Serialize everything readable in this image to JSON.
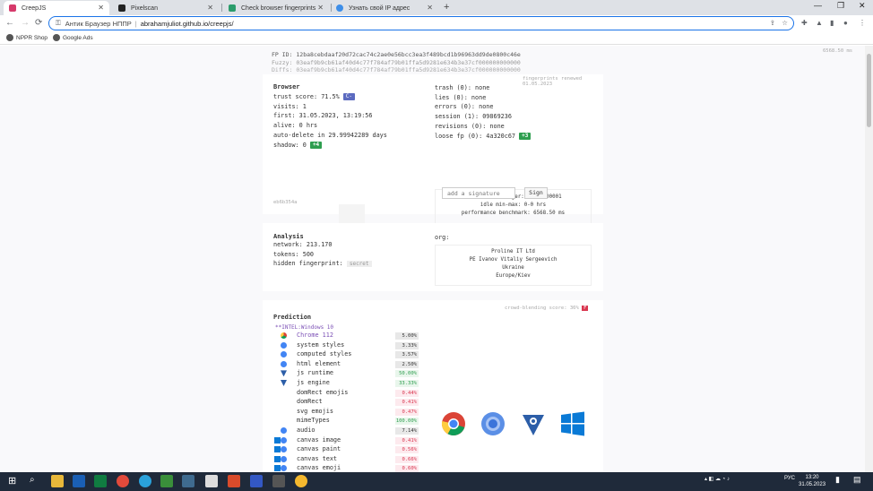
{
  "tabs": [
    {
      "title": "CreepJS",
      "active": true
    },
    {
      "title": "Pixelscan",
      "active": false
    },
    {
      "title": "Check browser fingerprints",
      "active": false
    },
    {
      "title": "Узнать свой IP адрес",
      "active": false
    }
  ],
  "newtab_label": "+",
  "window_controls": {
    "minimize": "—",
    "maximize": "❐",
    "close": "✕"
  },
  "toolbar": {
    "back": "←",
    "forward": "→",
    "reload": "⟳",
    "brand": "Антик Браузер НППР",
    "url": "abrahamjuliot.github.io/creepjs/"
  },
  "bookmarks": [
    "NPPR Shop",
    "Google Ads"
  ],
  "hashes": {
    "fp_id": "FP ID: 12ba8cebdaaf20d72cac74c2ae0e56bcc3ea3f489bcd1b96963dd9de0800c46e",
    "fuzzy": "Fuzzy: 03eaf9b9cb61af40d4c77f784af79b01ffa5d9281e634b3e37cf000000000000",
    "diffs": "Diffs: 03eaf9b9cb61af40d4c77f784af79b01ffa5d9281e634b3e37cf000000000000"
  },
  "perf_top": "6568.50 ms",
  "browser": {
    "title": "Browser",
    "trust_label": "trust score: 71.5%",
    "trust_grade": "C-",
    "visits": "visits: 1",
    "first": "first: 31.05.2023, 13:19:56",
    "alive": "alive: 0 hrs",
    "auto_delete": "auto-delete in 29.99942289 days",
    "shadow": "shadow: 0",
    "shadow_badge": "+4",
    "renewed": "fingerprints renewed 01.05.2023",
    "trash": "trash (0): none",
    "lies": "lies (0): none",
    "errors": "errors (0): none",
    "session": "session (1): 09869236",
    "revisions": "revisions (0): none",
    "loose": "loose fp (0): 4a320c67",
    "loose_badge": "+3",
    "bot": "bot: 0.13:stranger:cs1:00000001",
    "idle": "idle min-max: 0-0 hrs",
    "perf": "performance benchmark: 6568.50 ms",
    "hash_small": "eb6b354a",
    "sig_placeholder": "add a signature",
    "sign_label": "Sign"
  },
  "analysis": {
    "title": "Analysis",
    "network": "network: 213.170",
    "tokens": "tokens: 500",
    "hidden_label": "hidden fingerprint:",
    "hidden_value": "secret",
    "org_label": "org:",
    "org_lines": [
      "Proline IT Ltd",
      "PE Ivanov Vitaliy Sergeevich",
      "Ukraine",
      "Europe/Kiev"
    ]
  },
  "prediction": {
    "title": "Prediction",
    "crowd": "crowd-blending score: 36%",
    "crowd_grade": "F",
    "os_line": "**INTEL:Windows 10",
    "rows": [
      {
        "label": "Chrome 112",
        "pct": "5.00%",
        "tone": "gray",
        "icon": "chrome-icon"
      },
      {
        "label": "system styles",
        "pct": "3.33%",
        "tone": "gray",
        "icon": "chromium-icon"
      },
      {
        "label": "computed styles",
        "pct": "3.57%",
        "tone": "gray",
        "icon": "chromium-icon"
      },
      {
        "label": "html element",
        "pct": "2.50%",
        "tone": "gray",
        "icon": "chromium-icon"
      },
      {
        "label": "js runtime",
        "pct": "50.00%",
        "tone": "green",
        "icon": "v8-icon"
      },
      {
        "label": "js engine",
        "pct": "33.33%",
        "tone": "green",
        "icon": "v8-icon"
      },
      {
        "label": "domRect emojis",
        "pct": "0.44%",
        "tone": "red",
        "icon": ""
      },
      {
        "label": "domRect",
        "pct": "0.41%",
        "tone": "red",
        "icon": ""
      },
      {
        "label": "svg emojis",
        "pct": "0.47%",
        "tone": "red",
        "icon": ""
      },
      {
        "label": "mimeTypes",
        "pct": "100.00%",
        "tone": "green",
        "icon": ""
      },
      {
        "label": "audio",
        "pct": "7.14%",
        "tone": "gray",
        "icon": "chromium-icon"
      },
      {
        "label": "canvas image",
        "pct": "0.41%",
        "tone": "red",
        "icon": "windows-chromium-icon"
      },
      {
        "label": "canvas paint",
        "pct": "0.56%",
        "tone": "red",
        "icon": "windows-chromium-icon"
      },
      {
        "label": "canvas text",
        "pct": "0.66%",
        "tone": "red",
        "icon": "windows-chromium-icon"
      },
      {
        "label": "canvas emoji",
        "pct": "0.60%",
        "tone": "red",
        "icon": "windows-chromium-icon"
      }
    ]
  },
  "taskbar": {
    "lang": "РУС",
    "time": "13:20",
    "date": "31.05.2023"
  },
  "colors": {
    "accent": "#1a73e8",
    "grade_blue": "#5c6bc0",
    "badge_green": "#2e9e4f",
    "pct_red": "#d9364f",
    "taskbar": "#1f2a3a"
  }
}
